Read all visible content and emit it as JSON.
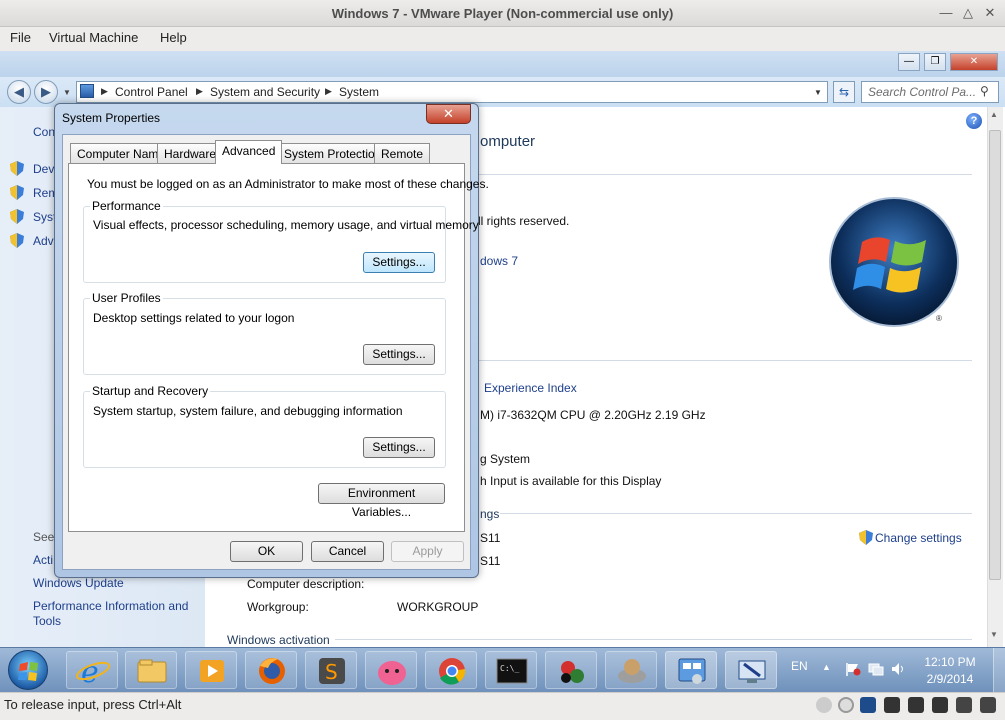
{
  "vmware": {
    "title": "Windows 7 - VMware Player (Non-commercial use only)",
    "menu": [
      "File",
      "Virtual Machine",
      "Help"
    ],
    "status_text": "To release input, press Ctrl+Alt"
  },
  "explorer": {
    "breadcrumbs": [
      "Control Panel",
      "System and Security",
      "System"
    ],
    "search_placeholder": "Search Control Pa...",
    "left_pane": {
      "header": "Con",
      "tasks": [
        "Dev",
        "Rem",
        "Syst",
        "Adv"
      ],
      "see_also_header": "See",
      "see_also": [
        "Acti",
        "Windows Update",
        "Performance Information and Tools"
      ]
    },
    "content": {
      "heading_fragment": "omputer",
      "rights_fragment": "ll rights reserved.",
      "edition_fragment": "dows 7",
      "wei_fragment": "Experience Index",
      "cpu_fragment": "M) i7-3632QM CPU @ 2.20GHz   2.19 GHz",
      "os_type_fragment": "g System",
      "pen_fragment": "h Input is available for this Display",
      "settings_fragment": "ngs",
      "name1_fragment": "S11",
      "name2_fragment": "S11",
      "change_settings": "Change settings",
      "computer_description_label": "Computer description:",
      "workgroup_label": "Workgroup:",
      "workgroup_value": "WORKGROUP",
      "windows_activation": "Windows activation"
    }
  },
  "dialog": {
    "title": "System Properties",
    "tabs": [
      "Computer Name",
      "Hardware",
      "Advanced",
      "System Protection",
      "Remote"
    ],
    "active_tab": "Advanced",
    "admin_note": "You must be logged on as an Administrator to make most of these changes.",
    "groups": [
      {
        "title": "Performance",
        "desc": "Visual effects, processor scheduling, memory usage, and virtual memory",
        "button": "Settings..."
      },
      {
        "title": "User Profiles",
        "desc": "Desktop settings related to your logon",
        "button": "Settings..."
      },
      {
        "title": "Startup and Recovery",
        "desc": "System startup, system failure, and debugging information",
        "button": "Settings..."
      }
    ],
    "env_button": "Environment Variables...",
    "ok": "OK",
    "cancel": "Cancel",
    "apply": "Apply"
  },
  "taskbar": {
    "language": "EN",
    "time": "12:10 PM",
    "date": "2/9/2014"
  }
}
